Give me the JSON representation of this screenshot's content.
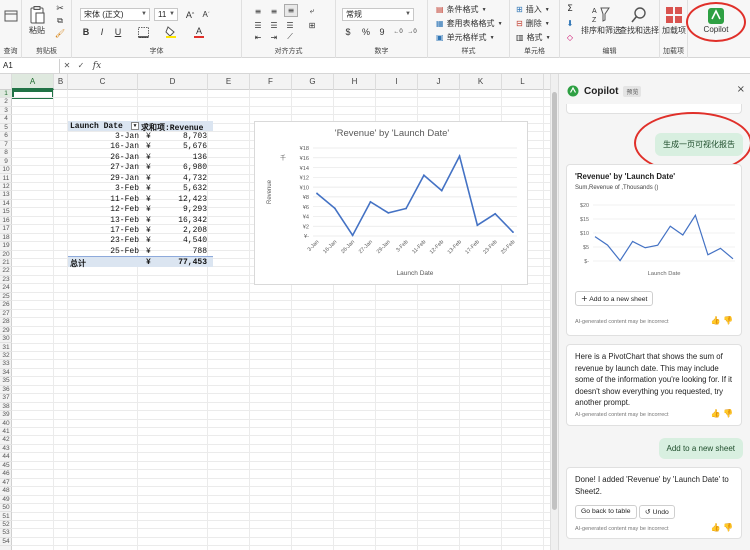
{
  "ribbon": {
    "paste_label": "粘贴",
    "groups": {
      "clipboard": "剪贴板",
      "font": "字体",
      "alignment": "对齐方式",
      "number": "数字",
      "styles": "样式",
      "cells": "单元格",
      "editing": "编辑",
      "addins": "加载项"
    },
    "left_cut_label": "查询",
    "font_name": "宋体 (正文)",
    "font_size": "11",
    "bold": "B",
    "italic": "I",
    "underline": "U",
    "number_format": "常规",
    "currency": "$",
    "percent": "%",
    "comma": "9",
    "conditional_format": "条件格式",
    "format_as_table": "套用表格格式",
    "cell_styles": "单元格样式",
    "insert": "插入",
    "delete": "删除",
    "format": "格式",
    "sort_filter": "排序和筛选",
    "find_select": "查找和选择",
    "addins_label": "加载项",
    "copilot_label": "Copilot"
  },
  "formula_bar": {
    "name_box": "A1",
    "fx": "fx",
    "content": ""
  },
  "grid": {
    "columns": [
      "A",
      "B",
      "C",
      "D",
      "E",
      "F",
      "G",
      "H",
      "I",
      "J",
      "K",
      "L"
    ],
    "selected_column": "A",
    "rows": [
      "1",
      "2",
      "3",
      "4",
      "5",
      "6",
      "7",
      "8",
      "9",
      "10",
      "11",
      "12",
      "13",
      "14",
      "15",
      "16",
      "17",
      "18",
      "19",
      "20",
      "21",
      "22",
      "23",
      "24",
      "25",
      "26",
      "27",
      "28",
      "29",
      "30",
      "31",
      "32",
      "33",
      "34",
      "35",
      "36",
      "37",
      "38",
      "39",
      "40",
      "41",
      "42",
      "43",
      "44",
      "45",
      "46",
      "47",
      "48",
      "49",
      "50",
      "51",
      "52",
      "53",
      "54"
    ],
    "selected_row": "1"
  },
  "pivot": {
    "col1_header": "Launch Date",
    "col2_header": "求和项:Revenue",
    "currency_symbol": "¥",
    "rows": [
      {
        "date": "3-Jan",
        "value": "8,703"
      },
      {
        "date": "16-Jan",
        "value": "5,676"
      },
      {
        "date": "26-Jan",
        "value": "136"
      },
      {
        "date": "27-Jan",
        "value": "6,980"
      },
      {
        "date": "29-Jan",
        "value": "4,732"
      },
      {
        "date": "3-Feb",
        "value": "5,632"
      },
      {
        "date": "11-Feb",
        "value": "12,423"
      },
      {
        "date": "12-Feb",
        "value": "9,293"
      },
      {
        "date": "13-Feb",
        "value": "16,342"
      },
      {
        "date": "17-Feb",
        "value": "2,208"
      },
      {
        "date": "23-Feb",
        "value": "4,540"
      },
      {
        "date": "25-Feb",
        "value": "788"
      }
    ],
    "total_label": "总计",
    "total_value": "77,453"
  },
  "chart_data": {
    "type": "line",
    "title": "'Revenue' by 'Launch Date'",
    "xlabel": "Launch Date",
    "ylabel": "Revenue",
    "unit_label": "千",
    "categories": [
      "3-Jan",
      "16-Jan",
      "26-Jan",
      "27-Jan",
      "29-Jan",
      "3-Feb",
      "11-Feb",
      "12-Feb",
      "13-Feb",
      "17-Feb",
      "23-Feb",
      "25-Feb"
    ],
    "values": [
      8.703,
      5.676,
      0.136,
      6.98,
      4.732,
      5.632,
      12.423,
      9.293,
      16.342,
      2.208,
      4.54,
      0.788
    ],
    "yticks": [
      "¥-",
      "¥2",
      "¥4",
      "¥6",
      "¥8",
      "¥10",
      "¥12",
      "¥14",
      "¥16",
      "¥18"
    ],
    "ylim": [
      0,
      18
    ],
    "grid": true,
    "legend": "none",
    "series_color": "#4472c4"
  },
  "copilot": {
    "title": "Copilot",
    "badge": "预览",
    "close": "×",
    "user_msg_1": "生成一页可视化报告",
    "card1_title": "'Revenue' by 'Launch Date'",
    "card1_subtitle": "Sum,Revenue of ,Thousands ()",
    "mini_chart": {
      "yticks": [
        "$-",
        "$5",
        "$10",
        "$15",
        "$20"
      ],
      "xlabel": "Launch Date",
      "ylim": [
        0,
        20
      ]
    },
    "add_to_sheet_btn": "Add to a new sheet",
    "disclaimer": "AI-generated content may be incorrect",
    "card2_text": "Here is a PivotChart that shows the sum of revenue by launch date. This may include some of the information you're looking for. If it doesn't show everything you requested, try another prompt.",
    "user_msg_2": "Add to a new sheet",
    "card3_text": "Done! I added 'Revenue' by 'Launch Date' to Sheet2.",
    "go_back_btn": "Go back to table",
    "undo_btn": "Undo",
    "colors": {
      "accent_red": "#e0302a",
      "user_bubble": "#d8efe0",
      "excel_green": "#217346"
    }
  }
}
